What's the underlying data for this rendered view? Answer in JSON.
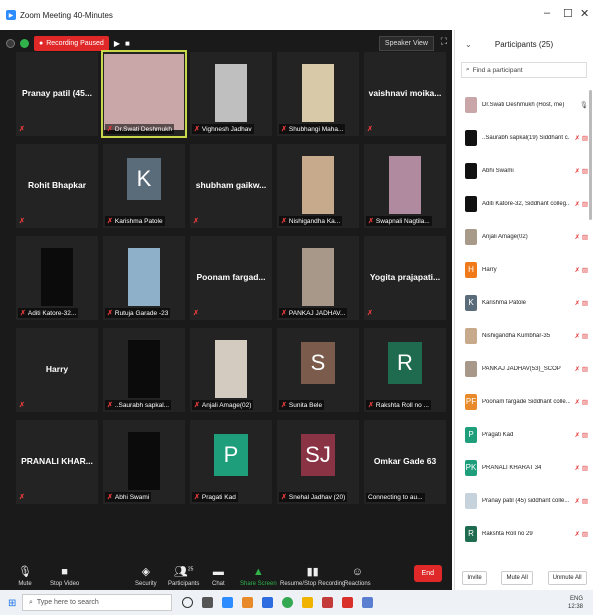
{
  "window": {
    "title": "Zoom Meeting 40-Minutes",
    "min": "–",
    "max": "☐",
    "close": "✕"
  },
  "topbar": {
    "recording": "Recording Paused",
    "view": "Speaker View"
  },
  "tiles": [
    {
      "name": "Pranay patil  (45...",
      "label": "",
      "type": "name"
    },
    {
      "name": "",
      "label": "Dr.Swati Deshmukh",
      "type": "video",
      "color": "#c9a6a8",
      "active": true
    },
    {
      "name": "",
      "label": "Vighnesh Jadhav",
      "type": "video",
      "color": "#bfbfbf"
    },
    {
      "name": "",
      "label": "Shubhangi Maha...",
      "type": "video",
      "color": "#d8c9a8"
    },
    {
      "name": "vaishnavi  moika...",
      "label": "",
      "type": "name"
    },
    {
      "name": "Rohit Bhapkar",
      "label": "",
      "type": "name"
    },
    {
      "name": "",
      "label": "Karishma Patole",
      "type": "avatar",
      "letter": "K",
      "color": "#5a6b7a"
    },
    {
      "name": "shubham  gaikw...",
      "label": "",
      "type": "name"
    },
    {
      "name": "",
      "label": "Nishigandha Ka...",
      "type": "video",
      "color": "#c7a98c"
    },
    {
      "name": "",
      "label": "Swapnali Nagtila...",
      "type": "video",
      "color": "#b08a9e"
    },
    {
      "name": "",
      "label": "Aditi Katore-32...",
      "type": "black"
    },
    {
      "name": "",
      "label": "Rutuja Garade -23",
      "type": "video",
      "color": "#8fb0c9"
    },
    {
      "name": "Poonam  fargad...",
      "label": "",
      "type": "name"
    },
    {
      "name": "",
      "label": "PANKAJ JADHAV...",
      "type": "video",
      "color": "#a7988a"
    },
    {
      "name": "Yogita  prajapati...",
      "label": "",
      "type": "name"
    },
    {
      "name": "Harry",
      "label": "",
      "type": "name"
    },
    {
      "name": "",
      "label": "..Saurabh sapkal...",
      "type": "black"
    },
    {
      "name": "",
      "label": "Anjali Amage(02)",
      "type": "video",
      "color": "#d3cbc0"
    },
    {
      "name": "",
      "label": "Sunita Bele",
      "type": "avatar",
      "letter": "S",
      "color": "#7a5b4c"
    },
    {
      "name": "",
      "label": "Rakshta Roll no ...",
      "type": "avatar",
      "letter": "R",
      "color": "#1f6b4f"
    },
    {
      "name": "PRANALI  KHAR...",
      "label": "",
      "type": "name"
    },
    {
      "name": "",
      "label": "Abhi Swami",
      "type": "black"
    },
    {
      "name": "",
      "label": "Pragati Kad",
      "type": "avatar",
      "letter": "P",
      "color": "#1f9e7c"
    },
    {
      "name": "",
      "label": "Snehal Jadhav (20)",
      "type": "avatar",
      "letter": "SJ",
      "color": "#8a3345"
    },
    {
      "name": "Omkar Gade 63",
      "label": "Connecting to au...",
      "type": "name",
      "connecting": true
    }
  ],
  "toolbar": {
    "mute": "Mute",
    "video": "Stop Video",
    "security": "Security",
    "participants": "Participants",
    "participants_count": "25",
    "chat": "Chat",
    "share": "Share Screen",
    "record": "Resume/Stop Recording",
    "reactions": "Reactions",
    "end": "End"
  },
  "panel": {
    "title": "Participants (25)",
    "search_placeholder": "Find a participant",
    "participants": [
      {
        "name": "Dr.Swati Deshmukh (Host, me)",
        "letter": "",
        "color": "#c9a6a8"
      },
      {
        "name": "..Saurabh sapkal(19) Siddhant c...",
        "letter": "",
        "color": "#111111"
      },
      {
        "name": "Abhi Swami",
        "letter": "",
        "color": "#111111"
      },
      {
        "name": "Aditi Katore-32, Siddhant colleg...",
        "letter": "",
        "color": "#111111"
      },
      {
        "name": "Anjali Amage(02)",
        "letter": "",
        "color": "#a89a88"
      },
      {
        "name": "Harry",
        "letter": "H",
        "color": "#f07a1a"
      },
      {
        "name": "Karishma Patole",
        "letter": "K",
        "color": "#5a6b7a"
      },
      {
        "name": "Nishigandha Kumbhar-35",
        "letter": "",
        "color": "#c7a98c"
      },
      {
        "name": "PANKAJ JADHAV(53)_SCOP",
        "letter": "",
        "color": "#a7988a"
      },
      {
        "name": "Poonam fargade Siddhant colle...",
        "letter": "PF",
        "color": "#e8892a"
      },
      {
        "name": "Pragati Kad",
        "letter": "P",
        "color": "#1f9e7c"
      },
      {
        "name": "PRANALI KHARAT 34",
        "letter": "PK",
        "color": "#1f9e7c"
      },
      {
        "name": "Pranay patil (45) siddhant colle...",
        "letter": "",
        "color": "#c6d2dc"
      },
      {
        "name": "Rakshta Roll no 29",
        "letter": "R",
        "color": "#1f6b4f"
      }
    ],
    "invite": "Invite",
    "mute_all": "Mute All",
    "unmute_all": "Unmute All"
  },
  "taskbar": {
    "search_placeholder": "Type here to search",
    "lang": "ENG",
    "time": "12:38"
  }
}
